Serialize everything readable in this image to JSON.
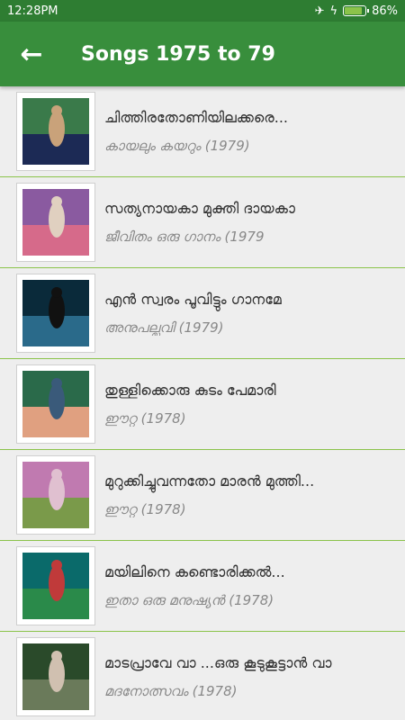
{
  "status": {
    "time": "12:28PM",
    "battery": "86%",
    "battery_level": 0.86,
    "icons": [
      "airplane-icon",
      "charging-icon",
      "battery-icon"
    ]
  },
  "appbar": {
    "back_icon": "back-arrow-icon",
    "title": "Songs 1975 to 79"
  },
  "songs": [
    {
      "title": "ചിത്തിരതോണിയിലക്കരെ...",
      "film": "കായലും കയറും (1979)",
      "thumb_colors": [
        "#3a7a4a",
        "#1c2a55",
        "#c9a27a"
      ]
    },
    {
      "title": "സത്യനായകാ മുക്തി ദായകാ",
      "film": "ജീവിതം ഒരു ഗാനം (1979",
      "thumb_colors": [
        "#8a5aa0",
        "#d66a8a",
        "#e0d0c0"
      ]
    },
    {
      "title": "എൻ സ്വരം പൂവിട്ടും ഗാനമേ",
      "film": "അനുപല്ലവി (1979)",
      "thumb_colors": [
        "#0a2a3a",
        "#2a6a8a",
        "#111111"
      ]
    },
    {
      "title": "തുള്ളിക്കൊരു കുടം പേമാരി",
      "film": "ഈറ്റ (1978)",
      "thumb_colors": [
        "#2a6a4a",
        "#e0a080",
        "#3a5a7a"
      ]
    },
    {
      "title": "മുറുക്കിച്ചുവന്നതോ മാരൻ മുത്തി...",
      "film": "ഈറ്റ (1978)",
      "thumb_colors": [
        "#c07ab0",
        "#7a9a4a",
        "#e0c0d0"
      ]
    },
    {
      "title": "മയിലിനെ കണ്ടൊരിക്കൽ...",
      "film": "ഇതാ ഒരു മനുഷ്യൻ (1978)",
      "thumb_colors": [
        "#0a6a6a",
        "#2a8a4a",
        "#c03a3a"
      ]
    },
    {
      "title": "മാടപ്രാവേ വാ ...ഒരു കൂടുകൂട്ടാൻ വാ",
      "film": "മദനോത്സവം (1978)",
      "thumb_colors": [
        "#2a4a2a",
        "#6a7a5a",
        "#d0c0b0"
      ]
    }
  ]
}
